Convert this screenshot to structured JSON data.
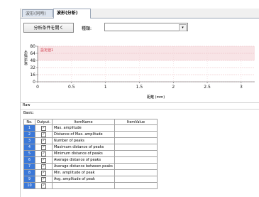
{
  "tabs": [
    {
      "label": "波形(同時)"
    },
    {
      "label": "波形(分析)"
    }
  ],
  "toolbar": {
    "open_button_label": "分析条件を開く",
    "type_label": "種類:",
    "type_value": ""
  },
  "chart_data": {
    "type": "line",
    "ylabel": "電流指令",
    "xlabel": "距離 (mm)",
    "annotation": "設定値1",
    "x_ticks": [
      "0",
      "0.5",
      "1",
      "1.5",
      "2",
      "2.5",
      "3"
    ],
    "y_ticks": [
      "80",
      "64",
      "48",
      "32",
      "16",
      "0"
    ],
    "xlim": [
      0,
      3.2
    ],
    "ylim": [
      0,
      80
    ],
    "series": [
      {
        "values": [
          0,
          0
        ]
      }
    ],
    "band": {
      "from": 48,
      "to": 80,
      "color": "#f8e4e6"
    },
    "grid": true
  },
  "raw": {
    "label": "Raw",
    "basic_label": "Basic:",
    "columns": [
      "No.",
      "Output.",
      "ItemName",
      "ItemValue"
    ],
    "rows": [
      {
        "no": "1",
        "name": "Max. amplitude"
      },
      {
        "no": "2",
        "name": "Distance of Max. amplitude"
      },
      {
        "no": "3",
        "name": "Number of peaks"
      },
      {
        "no": "4",
        "name": "Maximum distance of peaks"
      },
      {
        "no": "5",
        "name": "Minimum distance of peaks"
      },
      {
        "no": "6",
        "name": "Average distance of peaks"
      },
      {
        "no": "7",
        "name": "Average distance between peaks"
      },
      {
        "no": "8",
        "name": "Min. amplitude of peak"
      },
      {
        "no": "9",
        "name": "Avg. amplitude of peak"
      },
      {
        "no": "10",
        "name": ""
      }
    ]
  }
}
